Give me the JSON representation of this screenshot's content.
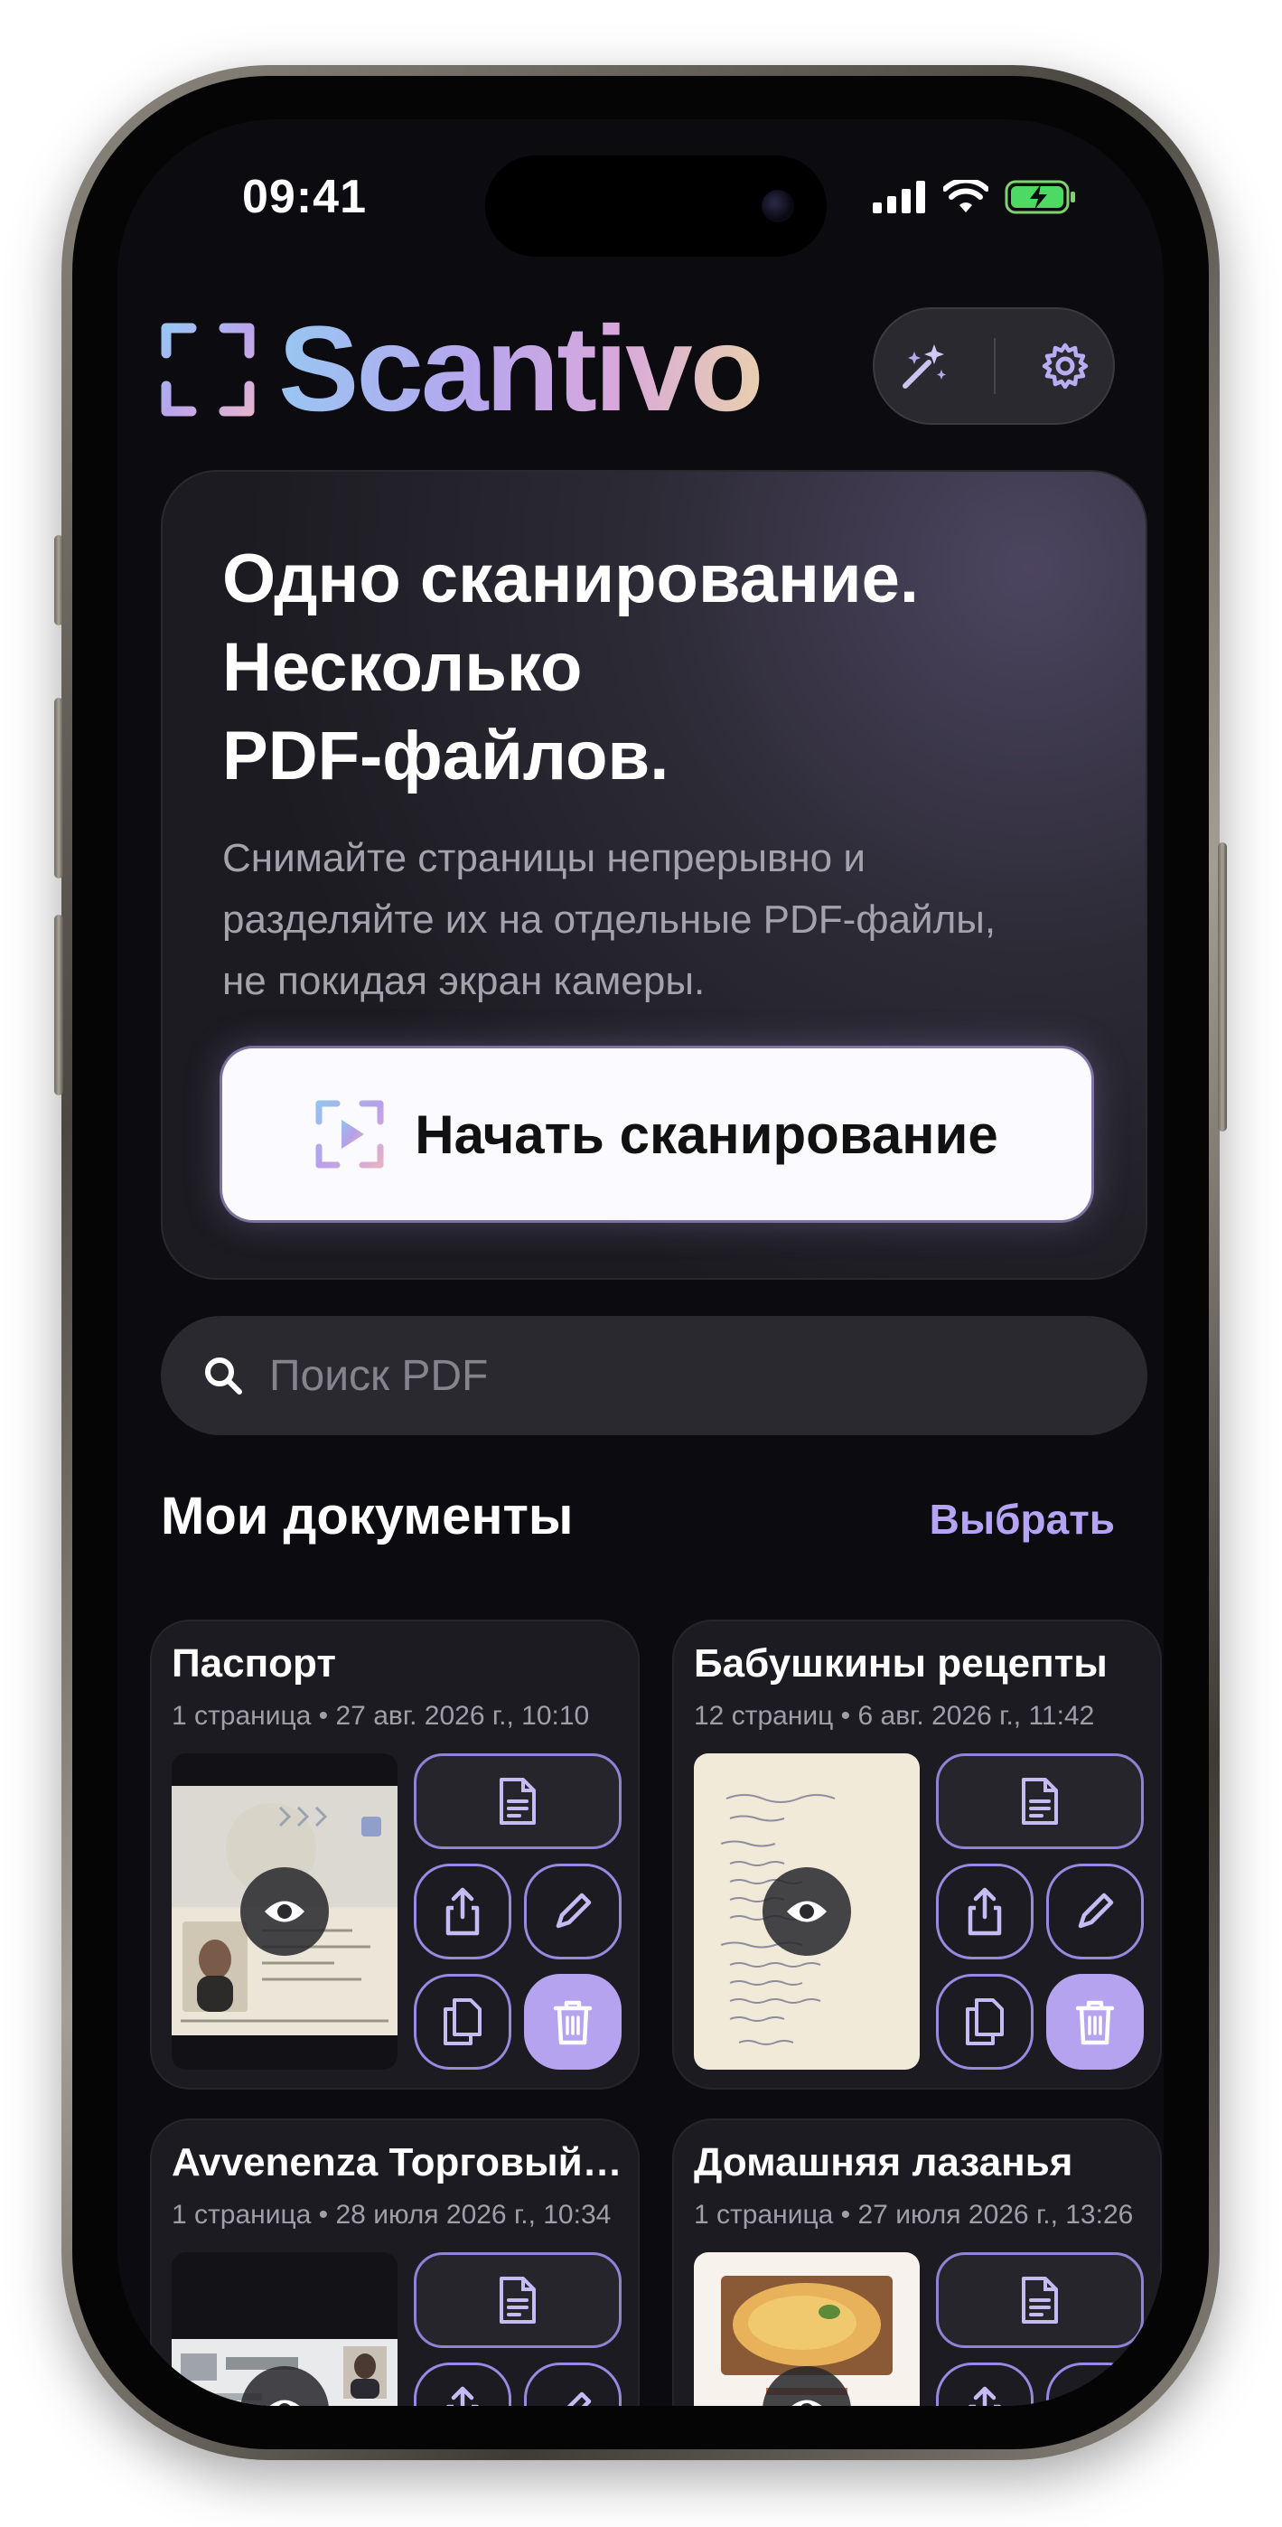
{
  "status_bar": {
    "time": "09:41"
  },
  "header": {
    "app_name": "Scantivo",
    "magic_icon": "magic-wand-icon",
    "settings_icon": "gear-icon"
  },
  "hero": {
    "title": "Одно сканирование.\nНесколько\nPDF-файлов.",
    "subtitle": "Снимайте страницы непрерывно и\nразделяйте их на отдельные PDF-файлы,\nне покидая экран камеры.",
    "start_button": "Начать сканирование"
  },
  "search": {
    "placeholder": "Поиск PDF"
  },
  "documents": {
    "title": "Мои документы",
    "select_label": "Выбрать",
    "items": [
      {
        "name": "Паспорт",
        "meta": "1 страница • 27 авг. 2026 г., 10:10"
      },
      {
        "name": "Бабушкины рецепты",
        "meta": "12 страниц • 6 авг. 2026 г., 11:42"
      },
      {
        "name": "Avvenenza Торговый…",
        "meta": "1 страница • 28 июля 2026 г., 10:34"
      },
      {
        "name": "Домашняя лазанья",
        "meta": "1 страница • 27 июля 2026 г., 13:26"
      }
    ]
  },
  "colors": {
    "accent": "#b5a4f6",
    "background": "#0c0b0f",
    "card": "#1c1b21"
  }
}
